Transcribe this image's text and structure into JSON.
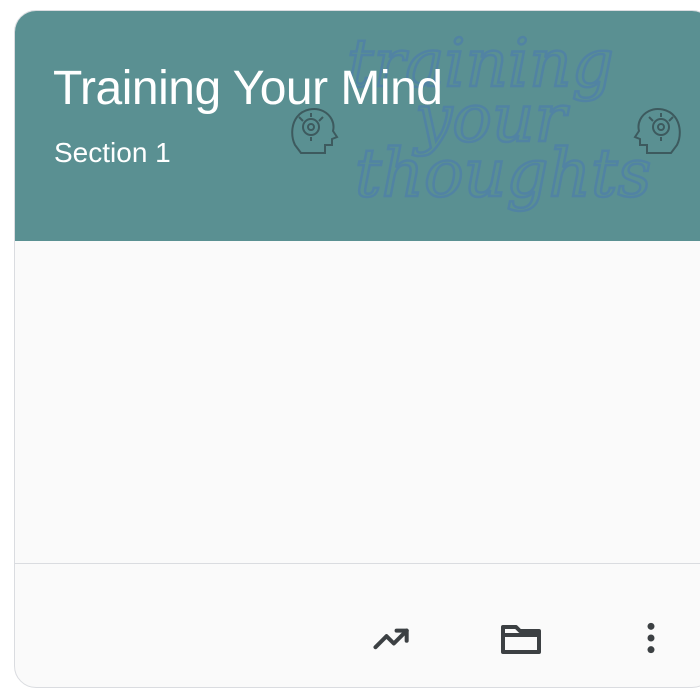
{
  "course_card": {
    "title": "Training Your Mind",
    "section": "Section 1",
    "header_color": "#5a9092",
    "banner_text_color": "#4f7fa8",
    "banner_lines": [
      "training",
      "your",
      "thoughts"
    ],
    "banner_icon": "brain-head-icon",
    "actions": [
      {
        "icon": "trending-up-icon"
      },
      {
        "icon": "folder-icon"
      },
      {
        "icon": "more-vert-icon"
      }
    ]
  }
}
